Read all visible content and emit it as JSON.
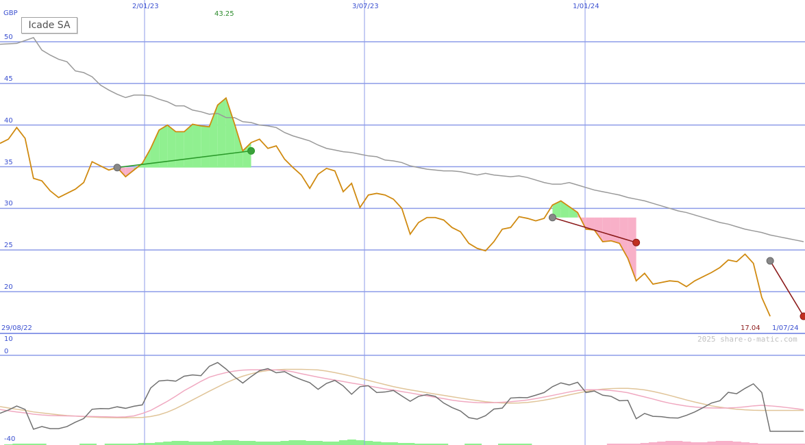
{
  "chart_data": {
    "type": "line",
    "title": "Icade SA",
    "currency_label": "GBP",
    "date_labels": [
      "2/01/23",
      "3/07/23",
      "1/01/24"
    ],
    "start_date_label": "29/08/22",
    "end_date_label": "1/07/24",
    "high_label": "43.25",
    "last_value_label": "17.04",
    "copyright": "2025 share-o-matic.com",
    "price_axis": {
      "ticks": [
        20,
        25,
        30,
        35,
        40,
        45,
        50
      ],
      "range": [
        15,
        52
      ]
    },
    "oscillator_axis": {
      "ticks": [
        10,
        0,
        -40
      ],
      "range": [
        -42,
        13
      ]
    },
    "grid": true,
    "colors": {
      "price": "#d08a10",
      "moving_average": "#999999",
      "grid": "#8c9be8",
      "gain_fill": "#90f090",
      "loss_fill": "#f8b0c8",
      "gain_trend": "#2a9a2a",
      "loss_trend": "#8b1a1a",
      "oscillator": "#707070",
      "osc_signal_pink": "#f0a8c0",
      "osc_signal_tan": "#e0c498",
      "text_blue": "#3a4fd0",
      "high_text": "#2a8a2a",
      "low_text": "#8b1a1a",
      "volume_green": "#90f090",
      "volume_pink": "#f8b0c8"
    },
    "x_range": [
      0,
      96
    ],
    "price_series": {
      "name": "",
      "x": [
        0,
        1,
        2,
        3,
        4,
        5,
        6,
        7,
        8,
        9,
        10,
        11,
        12,
        13,
        14,
        15,
        16,
        17,
        18,
        19,
        20,
        21,
        22,
        23,
        24,
        25,
        26,
        27,
        28,
        29,
        30,
        31,
        32,
        33,
        34,
        35,
        36,
        37,
        38,
        39,
        40,
        41,
        42,
        43,
        44,
        45,
        46,
        47,
        48,
        49,
        50,
        51,
        52,
        53,
        54,
        55,
        56,
        57,
        58,
        59,
        60,
        61,
        62,
        63,
        64,
        65,
        66,
        67,
        68,
        69,
        70,
        71,
        72,
        73,
        74,
        75,
        76,
        77,
        78,
        79,
        80,
        81,
        82,
        83,
        84,
        85,
        86,
        87,
        88,
        89,
        90,
        91,
        92,
        93,
        94,
        95,
        96
      ],
      "values": [
        37.8,
        38.3,
        39.7,
        38.4,
        33.6,
        33.3,
        32.1,
        31.3,
        31.8,
        32.3,
        33.1,
        35.6,
        35.1,
        34.6,
        34.9,
        33.8,
        34.6,
        35.4,
        37.2,
        39.4,
        40.0,
        39.2,
        39.2,
        40.1,
        39.9,
        39.8,
        42.4,
        43.25,
        40.2,
        36.9,
        37.9,
        38.3,
        37.2,
        37.5,
        35.9,
        34.9,
        34.0,
        32.4,
        34.1,
        34.8,
        34.5,
        32.0,
        33.0,
        30.1,
        31.6,
        31.8,
        31.6,
        31.1,
        30.0,
        26.9,
        28.3,
        28.9,
        28.9,
        28.6,
        27.7,
        27.2,
        25.8,
        25.2,
        24.9,
        26.0,
        27.5,
        27.7,
        29.0,
        28.8,
        28.5,
        28.8,
        30.4,
        30.9,
        30.2,
        29.5,
        27.5,
        27.4,
        26.0,
        26.1,
        25.8,
        24.0,
        21.3,
        22.2,
        20.9,
        21.1,
        21.3,
        21.2,
        20.6,
        21.3,
        21.8,
        22.3,
        22.9,
        23.8,
        23.6,
        24.5,
        23.4,
        19.3,
        17.04
      ]
    },
    "moving_average_series": {
      "name": "",
      "x": [
        0,
        2,
        4,
        5,
        6,
        7,
        8,
        9,
        10,
        11,
        12,
        13,
        14,
        15,
        16,
        17,
        18,
        19,
        20,
        21,
        22,
        23,
        24,
        25,
        26,
        27,
        28,
        29,
        30,
        31,
        32,
        33,
        34,
        35,
        36,
        37,
        38,
        39,
        40,
        41,
        42,
        43,
        44,
        45,
        46,
        47,
        48,
        49,
        50,
        51,
        52,
        53,
        54,
        55,
        56,
        57,
        58,
        59,
        60,
        61,
        62,
        63,
        64,
        65,
        66,
        67,
        68,
        69,
        70,
        71,
        72,
        73,
        74,
        75,
        76,
        77,
        78,
        79,
        80,
        81,
        82,
        83,
        84,
        85,
        86,
        87,
        88,
        89,
        90,
        91,
        92,
        93,
        94,
        95,
        96
      ],
      "values": [
        49.7,
        49.8,
        50.5,
        49.0,
        48.4,
        47.9,
        47.6,
        46.5,
        46.3,
        45.8,
        44.8,
        44.2,
        43.7,
        43.3,
        43.6,
        43.6,
        43.5,
        43.1,
        42.8,
        42.3,
        42.3,
        41.8,
        41.6,
        41.3,
        41.4,
        40.9,
        40.9,
        40.4,
        40.3,
        40.0,
        39.9,
        39.7,
        39.1,
        38.7,
        38.4,
        38.1,
        37.6,
        37.2,
        37.0,
        36.8,
        36.7,
        36.5,
        36.3,
        36.2,
        35.8,
        35.7,
        35.5,
        35.1,
        34.9,
        34.7,
        34.6,
        34.5,
        34.5,
        34.4,
        34.2,
        34.0,
        34.2,
        34.0,
        33.9,
        33.8,
        33.9,
        33.7,
        33.4,
        33.1,
        32.9,
        32.9,
        33.1,
        32.8,
        32.5,
        32.2,
        32.0,
        31.8,
        31.6,
        31.3,
        31.1,
        30.9,
        30.6,
        30.3,
        30.0,
        29.7,
        29.5,
        29.2,
        28.9,
        28.6,
        28.3,
        28.1,
        27.8,
        27.5,
        27.3,
        27.1,
        26.8,
        26.6,
        26.4,
        26.2,
        26.0
      ]
    },
    "trades": [
      {
        "result": "gain",
        "start": {
          "x": 14,
          "y": 34.9
        },
        "end": {
          "x": 30,
          "y": 36.9
        }
      },
      {
        "result": "loss",
        "start": {
          "x": 66,
          "y": 28.9
        },
        "end": {
          "x": 76,
          "y": 25.9
        }
      },
      {
        "result": "loss",
        "start": {
          "x": 92,
          "y": 23.7
        },
        "end": {
          "x": 96,
          "y": 17.04
        }
      }
    ],
    "oscillator": {
      "x": [
        0,
        1,
        2,
        3,
        4,
        5,
        6,
        7,
        8,
        9,
        10,
        11,
        12,
        13,
        14,
        15,
        16,
        17,
        18,
        19,
        20,
        21,
        22,
        23,
        24,
        25,
        26,
        27,
        28,
        29,
        30,
        31,
        32,
        33,
        34,
        35,
        36,
        37,
        38,
        39,
        40,
        41,
        42,
        43,
        44,
        45,
        46,
        47,
        48,
        49,
        50,
        51,
        52,
        53,
        54,
        55,
        56,
        57,
        58,
        59,
        60,
        61,
        62,
        63,
        64,
        65,
        66,
        67,
        68,
        69,
        70,
        71,
        72,
        73,
        74,
        75,
        76,
        77,
        78,
        79,
        80,
        81,
        82,
        83,
        84,
        85,
        86,
        87,
        88,
        89,
        90,
        91,
        92,
        93,
        94,
        95,
        96
      ],
      "main": [
        -30.5,
        -28.8,
        -26.7,
        -28.5,
        -38.9,
        -37.5,
        -38.6,
        -38.6,
        -37.5,
        -35.2,
        -33.3,
        -28.4,
        -28.0,
        -28.1,
        -27.1,
        -27.9,
        -26.8,
        -26.1,
        -17.2,
        -13.5,
        -13.1,
        -13.6,
        -11.0,
        -10.3,
        -10.7,
        -5.8,
        -3.8,
        -7.2,
        -11.3,
        -14.6,
        -11.2,
        -8.1,
        -7.0,
        -9.2,
        -8.6,
        -11.0,
        -12.8,
        -14.4,
        -17.9,
        -14.8,
        -13.2,
        -16.1,
        -20.5,
        -16.5,
        -16.0,
        -19.6,
        -19.3,
        -18.5,
        -21.4,
        -24.2,
        -21.6,
        -20.7,
        -21.6,
        -25.1,
        -27.5,
        -29.3,
        -32.8,
        -33.6,
        -31.8,
        -28.3,
        -27.8,
        -22.5,
        -22.2,
        -22.3,
        -21.0,
        -19.6,
        -16.5,
        -14.5,
        -15.6,
        -14.2,
        -19.6,
        -18.8,
        -21.0,
        -21.6,
        -23.9,
        -23.7,
        -33.4,
        -30.6,
        -32.1,
        -32.3,
        -32.9,
        -33.0,
        -31.6,
        -29.8,
        -27.5,
        -25.1,
        -23.9,
        -19.5,
        -20.2,
        -17.4,
        -15.0,
        -19.6,
        -40.0,
        -40.0,
        -40.0,
        -40.0,
        -40.0
      ],
      "signal_pink": [
        -28.5,
        -29.2,
        -29.8,
        -30.3,
        -31.0,
        -31.4,
        -31.7,
        -31.8,
        -31.9,
        -32.0,
        -32.1,
        -32.2,
        -32.3,
        -32.4,
        -32.5,
        -32.4,
        -31.9,
        -30.6,
        -29.0,
        -26.6,
        -24.2,
        -21.5,
        -18.6,
        -16.2,
        -13.7,
        -11.5,
        -10.2,
        -9.1,
        -8.3,
        -7.8,
        -7.6,
        -7.6,
        -7.6,
        -7.7,
        -8.0,
        -8.7,
        -9.7,
        -10.6,
        -11.5,
        -12.3,
        -13.0,
        -13.8,
        -14.6,
        -15.3,
        -16.1,
        -16.9,
        -17.7,
        -18.3,
        -19.1,
        -19.8,
        -20.6,
        -21.3,
        -22.1,
        -22.8,
        -23.6,
        -24.2,
        -24.6,
        -24.9,
        -25.0,
        -24.9,
        -24.7,
        -24.4,
        -24.0,
        -23.5,
        -22.8,
        -22.0,
        -21.1,
        -20.2,
        -19.3,
        -18.5,
        -18.1,
        -18.1,
        -18.2,
        -18.5,
        -19.0,
        -19.7,
        -20.8,
        -21.9,
        -23.0,
        -24.2,
        -25.2,
        -26.0,
        -26.7,
        -27.2,
        -27.6,
        -27.7,
        -27.8,
        -27.7,
        -27.5,
        -27.1,
        -26.6,
        -26.3,
        -26.6,
        -27.0,
        -27.5,
        -28.0,
        -28.6
      ],
      "signal_tan": [
        -27.0,
        -27.7,
        -28.4,
        -29.0,
        -29.8,
        -30.3,
        -30.8,
        -31.3,
        -31.7,
        -32.0,
        -32.3,
        -32.5,
        -32.7,
        -32.8,
        -32.9,
        -32.9,
        -32.8,
        -32.7,
        -32.2,
        -31.3,
        -29.9,
        -28.0,
        -25.8,
        -23.5,
        -21.2,
        -18.9,
        -16.7,
        -14.5,
        -12.6,
        -11.0,
        -9.7,
        -8.7,
        -8.0,
        -7.6,
        -7.4,
        -7.4,
        -7.4,
        -7.5,
        -7.7,
        -8.3,
        -9.1,
        -10.0,
        -11.0,
        -12.1,
        -13.2,
        -14.3,
        -15.4,
        -16.5,
        -17.4,
        -18.2,
        -18.9,
        -19.7,
        -20.4,
        -21.1,
        -21.8,
        -22.5,
        -23.2,
        -23.8,
        -24.4,
        -24.8,
        -25.1,
        -25.2,
        -25.1,
        -24.8,
        -24.3,
        -23.6,
        -22.8,
        -21.8,
        -20.8,
        -19.9,
        -19.0,
        -18.3,
        -17.8,
        -17.5,
        -17.4,
        -17.4,
        -17.7,
        -18.2,
        -19.0,
        -20.0,
        -21.1,
        -22.3,
        -23.5,
        -24.6,
        -25.6,
        -26.6,
        -27.3,
        -27.9,
        -28.4,
        -28.7,
        -28.9,
        -29.0,
        -29.0,
        -29.0,
        -29.0,
        -29.0,
        -29.0
      ]
    },
    "volume_bars": {
      "x": [
        1,
        2,
        3,
        4,
        5,
        6,
        7,
        8,
        9,
        10,
        11,
        12,
        13,
        14,
        15,
        16,
        17,
        18,
        19,
        20,
        21,
        22,
        23,
        24,
        25,
        26,
        27,
        28,
        29,
        30,
        31,
        32,
        33,
        34,
        35,
        36,
        37,
        38,
        39,
        40,
        41,
        42,
        43,
        44,
        45,
        46,
        47,
        48,
        49,
        50,
        51,
        52,
        53,
        54,
        55,
        56,
        57,
        58,
        59,
        60,
        61,
        62,
        63,
        64,
        65,
        66,
        67,
        68,
        69,
        70,
        71,
        72,
        73,
        74,
        75,
        76,
        77,
        78,
        79,
        80,
        81,
        82,
        83,
        84,
        85,
        86,
        87,
        88,
        89,
        90,
        91,
        92,
        93,
        94,
        95,
        96
      ],
      "values": [
        1,
        2,
        2,
        2,
        2,
        0,
        0,
        0,
        0,
        2,
        2,
        0,
        2,
        2,
        2,
        2,
        3,
        3,
        4,
        5,
        6,
        6,
        5,
        5,
        5,
        6,
        7,
        7,
        6,
        6,
        5,
        5,
        5,
        6,
        7,
        7,
        6,
        6,
        5,
        5,
        7,
        8,
        7,
        6,
        5,
        4,
        4,
        3,
        3,
        2,
        2,
        2,
        2,
        0,
        0,
        2,
        2,
        0,
        0,
        2,
        2,
        2,
        2,
        0,
        0,
        0,
        0,
        0,
        0,
        0,
        0,
        0,
        -2,
        -2,
        -2,
        -2,
        -3,
        -4,
        -5,
        -6,
        -6,
        -5,
        -4,
        -4,
        -5,
        -6,
        -6,
        -5,
        -4,
        -3,
        -2,
        -2,
        -2,
        -2,
        -2,
        -2
      ],
      "note": ""
    }
  }
}
